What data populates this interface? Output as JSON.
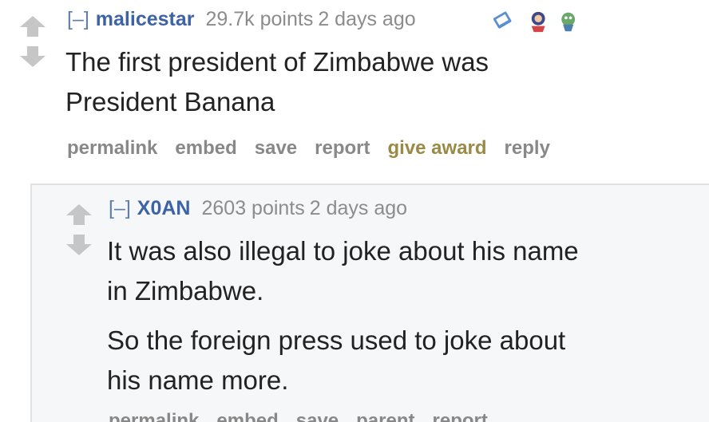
{
  "parent_comment": {
    "expand": "[–]",
    "author": "malicestar",
    "score": "29.7k points",
    "time": "2 days ago",
    "awards": [
      "gold-award-icon",
      "red-award-icon",
      "green-award-icon"
    ],
    "body": [
      "The first president of Zimbabwe was",
      "President Banana"
    ],
    "buttons": {
      "permalink": "permalink",
      "embed": "embed",
      "save": "save",
      "report": "report",
      "give_award": "give award",
      "reply": "reply"
    }
  },
  "child_comment": {
    "expand": "[–]",
    "author": "X0AN",
    "score": "2603 points",
    "time": "2 days ago",
    "paragraphs": [
      [
        "It was also illegal to joke about his name",
        "in Zimbabwe."
      ],
      [
        "So the foreign press used to joke about",
        "his name more."
      ]
    ],
    "buttons": {
      "permalink": "permalink",
      "embed": "embed",
      "save": "save",
      "parent": "parent",
      "report": "report"
    }
  },
  "colors": {
    "author": "#3d62a6",
    "meta": "#8c8c8c",
    "buttons": "#888888",
    "give_award": "#9a8a45",
    "child_background": "#f6f7f8"
  }
}
